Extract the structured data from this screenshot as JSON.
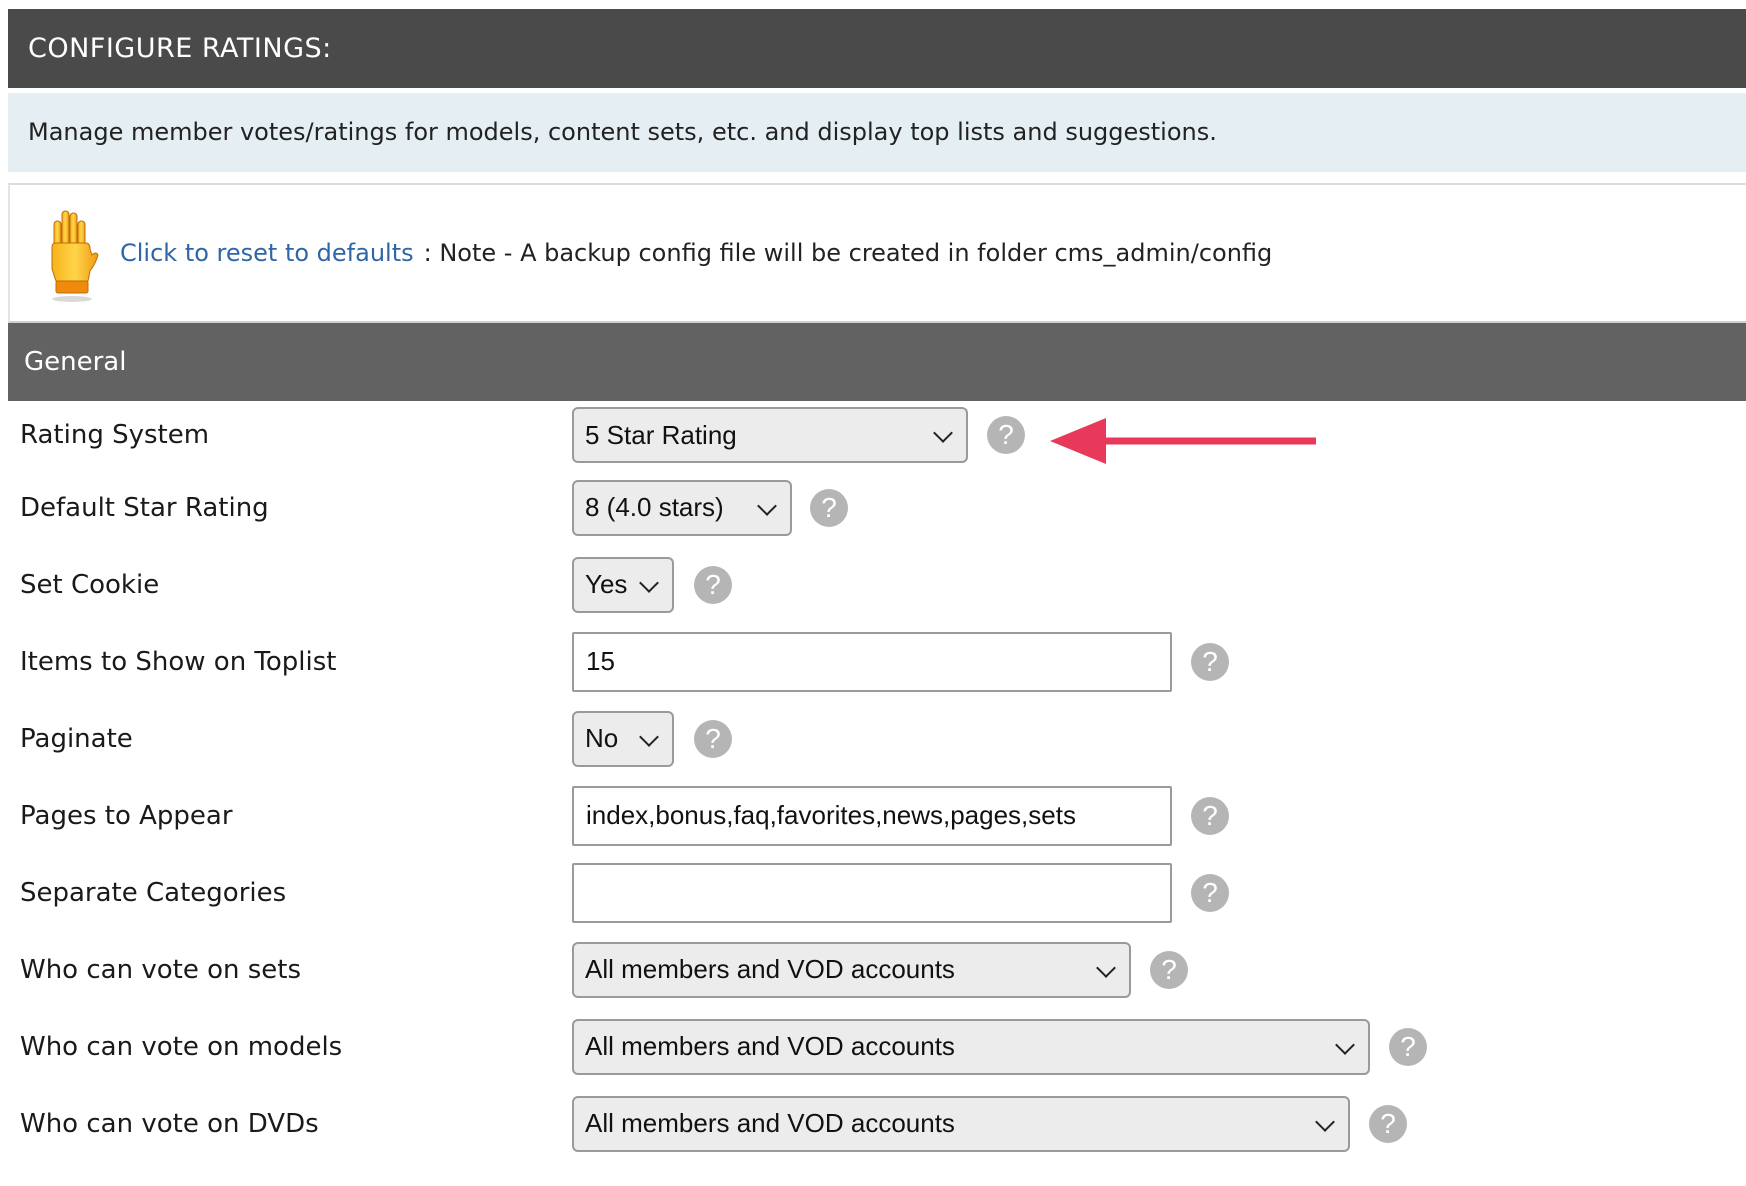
{
  "header": {
    "title": "CONFIGURE RATINGS:"
  },
  "info": {
    "text": "Manage member votes/ratings for models, content sets, etc. and display top lists and suggestions."
  },
  "reset": {
    "link_label": "Click to reset to defaults",
    "note": ": Note - A backup config file will be created in folder cms_admin/config",
    "icon": "hand-stop-icon"
  },
  "section": {
    "title": "General"
  },
  "annotation": {
    "arrow_color": "#e8395a"
  },
  "help_label": "?",
  "fields": {
    "rating_system": {
      "label": "Rating System",
      "value": "5 Star Rating"
    },
    "default_star_rating": {
      "label": "Default Star Rating",
      "value": "8 (4.0 stars)"
    },
    "set_cookie": {
      "label": "Set Cookie",
      "value": "Yes"
    },
    "items_toplist": {
      "label": "Items to Show on Toplist",
      "value": "15"
    },
    "paginate": {
      "label": "Paginate",
      "value": "No"
    },
    "pages_to_appear": {
      "label": "Pages to Appear",
      "value": "index,bonus,faq,favorites,news,pages,sets"
    },
    "separate_categories": {
      "label": "Separate Categories",
      "value": ""
    },
    "vote_sets": {
      "label": "Who can vote on sets",
      "value": "All members and VOD accounts"
    },
    "vote_models": {
      "label": "Who can vote on models",
      "value": "All members and VOD accounts"
    },
    "vote_dvds": {
      "label": "Who can vote on DVDs",
      "value": "All members and VOD accounts"
    }
  }
}
